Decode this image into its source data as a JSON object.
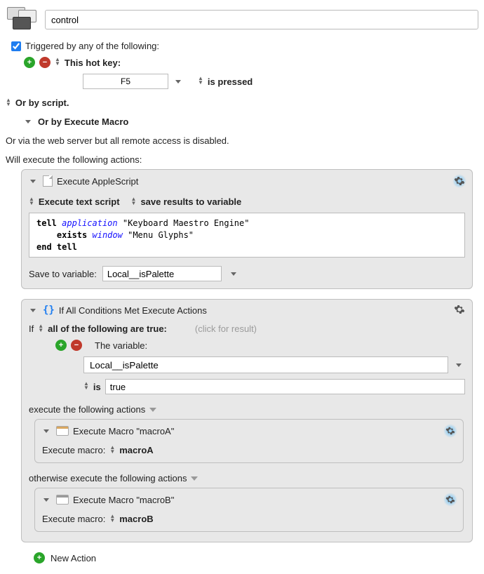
{
  "title": "control",
  "triggered_checked": true,
  "triggered_label": "Triggered by any of the following:",
  "hotkey": {
    "this_label": "This hot key:",
    "key": "F5",
    "is_pressed": "is pressed"
  },
  "or_script": "Or by script.",
  "or_execute_macro": "Or by Execute Macro",
  "or_web": "Or via the web server but all remote access is disabled.",
  "will_execute": "Will execute the following actions:",
  "action1": {
    "title": "Execute AppleScript",
    "exec_label": "Execute text script",
    "save_label": "save results to variable",
    "line1_tell": "tell",
    "line1_app": "application",
    "line1_str": "\"Keyboard Maestro Engine\"",
    "line2_exists": "exists",
    "line2_window": "window",
    "line2_str": "\"Menu Glyphs\"",
    "line3": "end tell",
    "save_to_label": "Save to variable:",
    "save_var": "Local__isPalette"
  },
  "action2": {
    "title": "If All Conditions Met Execute Actions",
    "if": "If",
    "all_true": "all of the following are true:",
    "click_hint": "(click for result)",
    "the_variable": "The variable:",
    "variable_name": "Local__isPalette",
    "is": "is",
    "value": "true",
    "execute_label": "execute the following actions",
    "otherwise_label": "otherwise execute the following actions",
    "macroA": {
      "title": "Execute Macro \"macroA\"",
      "exec_label": "Execute macro:",
      "name": "macroA"
    },
    "macroB": {
      "title": "Execute Macro \"macroB\"",
      "exec_label": "Execute macro:",
      "name": "macroB"
    }
  },
  "new_action": "New Action"
}
